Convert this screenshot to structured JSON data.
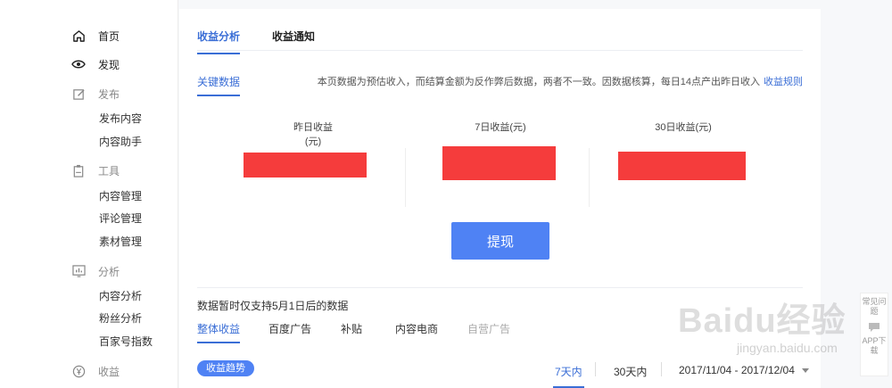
{
  "sidebar": {
    "items": [
      {
        "label": "首页",
        "icon": "home-icon"
      },
      {
        "label": "发现",
        "icon": "eye-icon"
      },
      {
        "label": "发布",
        "icon": "edit-icon"
      },
      {
        "label": "工具",
        "icon": "clipboard-icon"
      },
      {
        "label": "分析",
        "icon": "chart-icon"
      },
      {
        "label": "收益",
        "icon": "yuan-icon"
      }
    ],
    "publish_sub": [
      "发布内容",
      "内容助手"
    ],
    "tools_sub": [
      "内容管理",
      "评论管理",
      "素材管理"
    ],
    "analysis_sub": [
      "内容分析",
      "粉丝分析",
      "百家号指数"
    ]
  },
  "tabs": {
    "revenue_analysis": "收益分析",
    "revenue_notice": "收益通知"
  },
  "key_data": {
    "tab": "关键数据",
    "notice": "本页数据为预估收入，而结算金额为反作弊后数据，两者不一致。因数据核算，每日14点产出昨日收入",
    "rules_link": "收益规则"
  },
  "stats": [
    {
      "label": "昨日收益(元)"
    },
    {
      "label": "7日收益(元)"
    },
    {
      "label": "30日收益(元)"
    }
  ],
  "withdraw_label": "提现",
  "data_note": "数据暂时仅支持5月1日后的数据",
  "revenue_tabs": [
    "整体收益",
    "百度广告",
    "补贴",
    "内容电商",
    "自营广告"
  ],
  "trend": {
    "pill": "收益趋势",
    "range_7": "7天内",
    "range_30": "30天内",
    "date_range": "2017/11/04 - 2017/12/04"
  },
  "float_help": {
    "faq": "常见问题",
    "app": "APP下载"
  },
  "watermark": {
    "brand": "Baidu经验",
    "url": "jingyan.baidu.com"
  },
  "colors": {
    "accent": "#3a6ed6",
    "button": "#4f82f4",
    "redact": "#f53c3c"
  }
}
